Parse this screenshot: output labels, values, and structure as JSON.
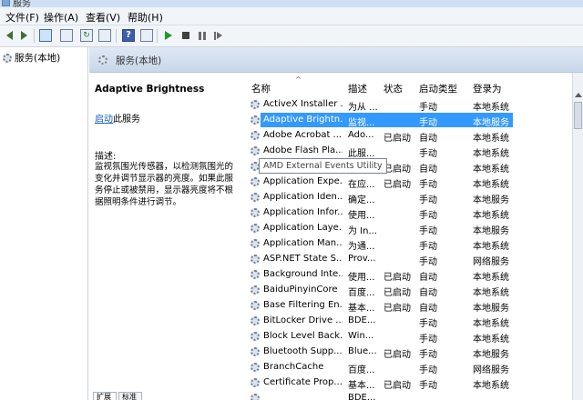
{
  "window": {
    "title": "服务"
  },
  "menu": [
    "文件(F)",
    "操作(A)",
    "查看(V)",
    "帮助(H)"
  ],
  "tree": {
    "root_label": "服务(本地)"
  },
  "main_header": {
    "label": "服务(本地)"
  },
  "description_pane": {
    "title": "Adaptive Brightness",
    "start_link": "启动",
    "start_suffix": "此服务",
    "desc_label": "描述:",
    "desc_text": "监视氛围光传感器，以检测氛围光的变化并调节显示器的亮度。如果此服务停止或被禁用，显示器亮度将不根据照明条件进行调节。"
  },
  "bottom_tabs": [
    "扩展",
    "标准"
  ],
  "list": {
    "columns": [
      "名称",
      "描述",
      "状态",
      "启动类型",
      "登录为"
    ],
    "rows": [
      {
        "name": "ActiveX Installer ...",
        "desc": "为从 ...",
        "state": "",
        "startup": "手动",
        "logon": "本地系统"
      },
      {
        "name": "Adaptive Brightn...",
        "desc": "监视...",
        "state": "",
        "startup": "手动",
        "logon": "本地服务"
      },
      {
        "name": "Adobe Acrobat ...",
        "desc": "Ado...",
        "state": "已启动",
        "startup": "自动",
        "logon": "本地系统"
      },
      {
        "name": "Adobe Flash Pla...",
        "desc": "此服...",
        "state": "",
        "startup": "手动",
        "logon": "本地系统"
      },
      {
        "name": "",
        "desc": "",
        "state": "已启动",
        "startup": "自动",
        "logon": "本地系统"
      },
      {
        "name": "Application Expe...",
        "desc": "在应...",
        "state": "已启动",
        "startup": "手动",
        "logon": "本地系统"
      },
      {
        "name": "Application Iden...",
        "desc": "确定...",
        "state": "",
        "startup": "手动",
        "logon": "本地服务"
      },
      {
        "name": "Application Infor...",
        "desc": "使用...",
        "state": "",
        "startup": "手动",
        "logon": "本地系统"
      },
      {
        "name": "Application Laye...",
        "desc": "为 In...",
        "state": "",
        "startup": "手动",
        "logon": "本地服务"
      },
      {
        "name": "Application Man...",
        "desc": "为通...",
        "state": "",
        "startup": "手动",
        "logon": "本地系统"
      },
      {
        "name": "ASP.NET State S...",
        "desc": "Prov...",
        "state": "",
        "startup": "手动",
        "logon": "网络服务"
      },
      {
        "name": "Background Inte...",
        "desc": "使用...",
        "state": "已启动",
        "startup": "自动",
        "logon": "本地系统"
      },
      {
        "name": "BaiduPinyinCore",
        "desc": "百度...",
        "state": "已启动",
        "startup": "自动",
        "logon": "本地系统"
      },
      {
        "name": "Base Filtering En...",
        "desc": "基本...",
        "state": "已启动",
        "startup": "自动",
        "logon": "本地服务"
      },
      {
        "name": "BitLocker Drive ...",
        "desc": "BDE...",
        "state": "",
        "startup": "手动",
        "logon": "本地系统"
      },
      {
        "name": "Block Level Back...",
        "desc": "Win...",
        "state": "",
        "startup": "手动",
        "logon": "本地系统"
      },
      {
        "name": "Bluetooth Supp...",
        "desc": "Blue...",
        "state": "已启动",
        "startup": "手动",
        "logon": "本地服务"
      },
      {
        "name": "BranchCache",
        "desc": "百度...",
        "state": "",
        "startup": "手动",
        "logon": "网络服务"
      },
      {
        "name": "Certificate Prop...",
        "desc": "基本...",
        "state": "已启动",
        "startup": "手动",
        "logon": "本地系统"
      },
      {
        "name": "",
        "desc": "BDE...",
        "state": "",
        "startup": "",
        "logon": ""
      }
    ],
    "selected_index": 1
  },
  "tooltip": "AMD External Events Utility"
}
